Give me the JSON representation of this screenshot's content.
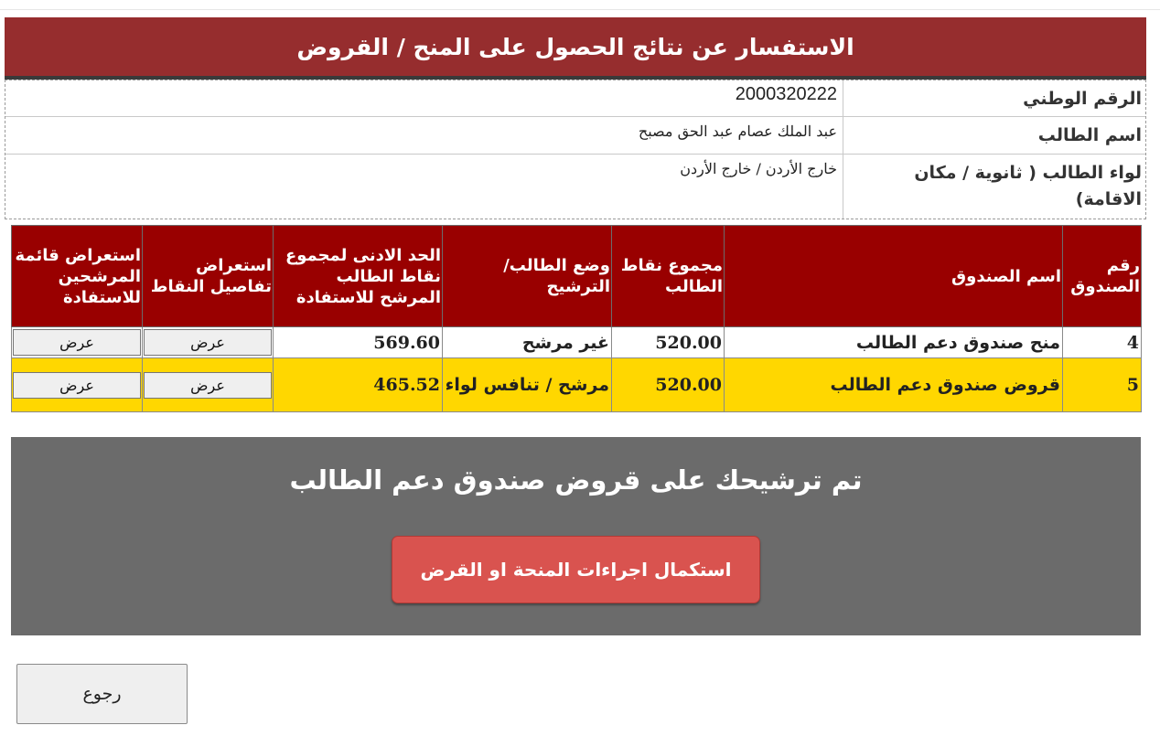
{
  "header": {
    "title": "الاستفسار عن نتائج الحصول على المنح / القروض"
  },
  "info": {
    "national_id_label": "الرقم الوطني",
    "national_id_value": "2000320222",
    "student_name_label": "اسم الطالب",
    "student_name_value": "عبد الملك عصام عبد الحق مصبح",
    "district_label": "لواء الطالب ( ثانوية / مكان الاقامة)",
    "district_value": "خارج الأردن / خارج الأردن"
  },
  "funds_table": {
    "headers": [
      "رقم الصندوق",
      "اسم الصندوق",
      "مجموع نقاط الطالب",
      "وضع الطالب/ الترشيح",
      "الحد الادنى لمجموع نقاط الطالب المرشح للاستفادة",
      "استعراض تفاصيل النقاط",
      "استعراض قائمة المرشحين للاستفادة"
    ],
    "rows": [
      {
        "fund_no": "4",
        "fund_name": "منح صندوق دعم الطالب",
        "student_points": "520.00",
        "status": "غير مرشح",
        "min_points": "569.60",
        "details_btn": "عرض",
        "list_btn": "عرض"
      },
      {
        "fund_no": "5",
        "fund_name": "قروض صندوق دعم الطالب",
        "student_points": "520.00",
        "status": "مرشح / تنافس لواء",
        "min_points": "465.52",
        "details_btn": "عرض",
        "list_btn": "عرض"
      }
    ]
  },
  "nomination": {
    "message": "تم ترشيحك على قروض صندوق دعم الطالب",
    "complete_button": "استكمال اجراءات المنحة او القرض"
  },
  "back_button": "رجوع",
  "colors": {
    "header_bg": "#962d2e",
    "table_header_bg": "#990000",
    "highlight_row": "#ffd700",
    "panel_bg": "#6b6b6b",
    "complete_button_bg": "#d9534f"
  }
}
